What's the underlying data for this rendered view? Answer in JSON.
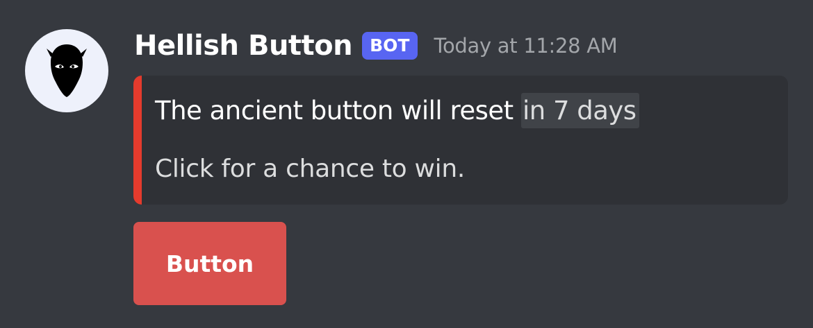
{
  "message": {
    "author": {
      "username": "Hellish Button",
      "bot_tag": "BOT",
      "avatar_icon": "hooded-face-icon"
    },
    "timestamp": "Today at 11:28 AM",
    "embed": {
      "accent_color": "#e53b2d",
      "title_prefix": "The ancient button will reset",
      "title_relative_time": "in 7 days",
      "description": "Click for a chance to win."
    },
    "components": {
      "button_label": "Button",
      "button_color": "#d9514e"
    }
  },
  "colors": {
    "background": "#36393f",
    "embed_background": "#2f3136",
    "bot_tag": "#5865f2"
  }
}
